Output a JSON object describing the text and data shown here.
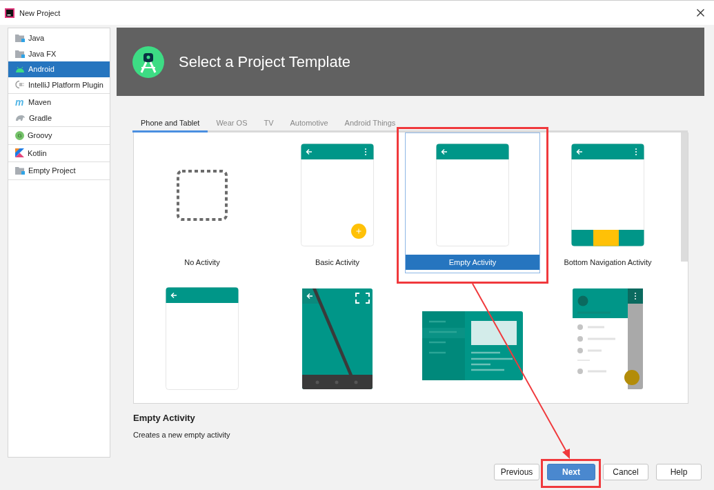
{
  "window": {
    "title": "New Project"
  },
  "sidebar": {
    "groups": [
      {
        "items": [
          {
            "label": "Java",
            "kind": "folder",
            "selected": false
          },
          {
            "label": "Java FX",
            "kind": "folder",
            "selected": false
          },
          {
            "label": "Android",
            "kind": "android",
            "selected": true
          },
          {
            "label": "IntelliJ Platform Plugin",
            "kind": "plug",
            "selected": false
          }
        ]
      },
      {
        "items": [
          {
            "label": "Maven",
            "kind": "letter",
            "icon_letter": "m",
            "selected": false
          },
          {
            "label": "Gradle",
            "kind": "elephant",
            "selected": false
          }
        ]
      },
      {
        "items": [
          {
            "label": "Groovy",
            "kind": "circle-letter",
            "icon_letter": "G",
            "selected": false
          }
        ]
      },
      {
        "items": [
          {
            "label": "Kotlin",
            "kind": "kotlin",
            "selected": false
          }
        ]
      },
      {
        "items": [
          {
            "label": "Empty Project",
            "kind": "folder",
            "selected": false
          }
        ]
      }
    ]
  },
  "header": {
    "title": "Select a Project Template"
  },
  "tabs": [
    {
      "label": "Phone and Tablet",
      "selected": true
    },
    {
      "label": "Wear OS",
      "selected": false
    },
    {
      "label": "TV",
      "selected": false
    },
    {
      "label": "Automotive",
      "selected": false
    },
    {
      "label": "Android Things",
      "selected": false
    }
  ],
  "templates": [
    {
      "name": "No Activity",
      "kind": "none",
      "selected": false
    },
    {
      "name": "Basic Activity",
      "kind": "basic",
      "selected": false
    },
    {
      "name": "Empty Activity",
      "kind": "empty",
      "selected": true
    },
    {
      "name": "Bottom Navigation Activity",
      "kind": "bottom-nav",
      "selected": false
    },
    {
      "kind": "plain",
      "selected": false
    },
    {
      "kind": "fullscreen",
      "selected": false
    },
    {
      "kind": "master-detail",
      "selected": false
    },
    {
      "kind": "drawer",
      "selected": false
    }
  ],
  "description": {
    "title": "Empty Activity",
    "text": "Creates a new empty activity"
  },
  "buttons": [
    {
      "label": "Previous",
      "kind": "default"
    },
    {
      "label": "Next",
      "kind": "primary"
    },
    {
      "label": "Cancel",
      "kind": "default"
    },
    {
      "label": "Help",
      "kind": "default"
    }
  ]
}
